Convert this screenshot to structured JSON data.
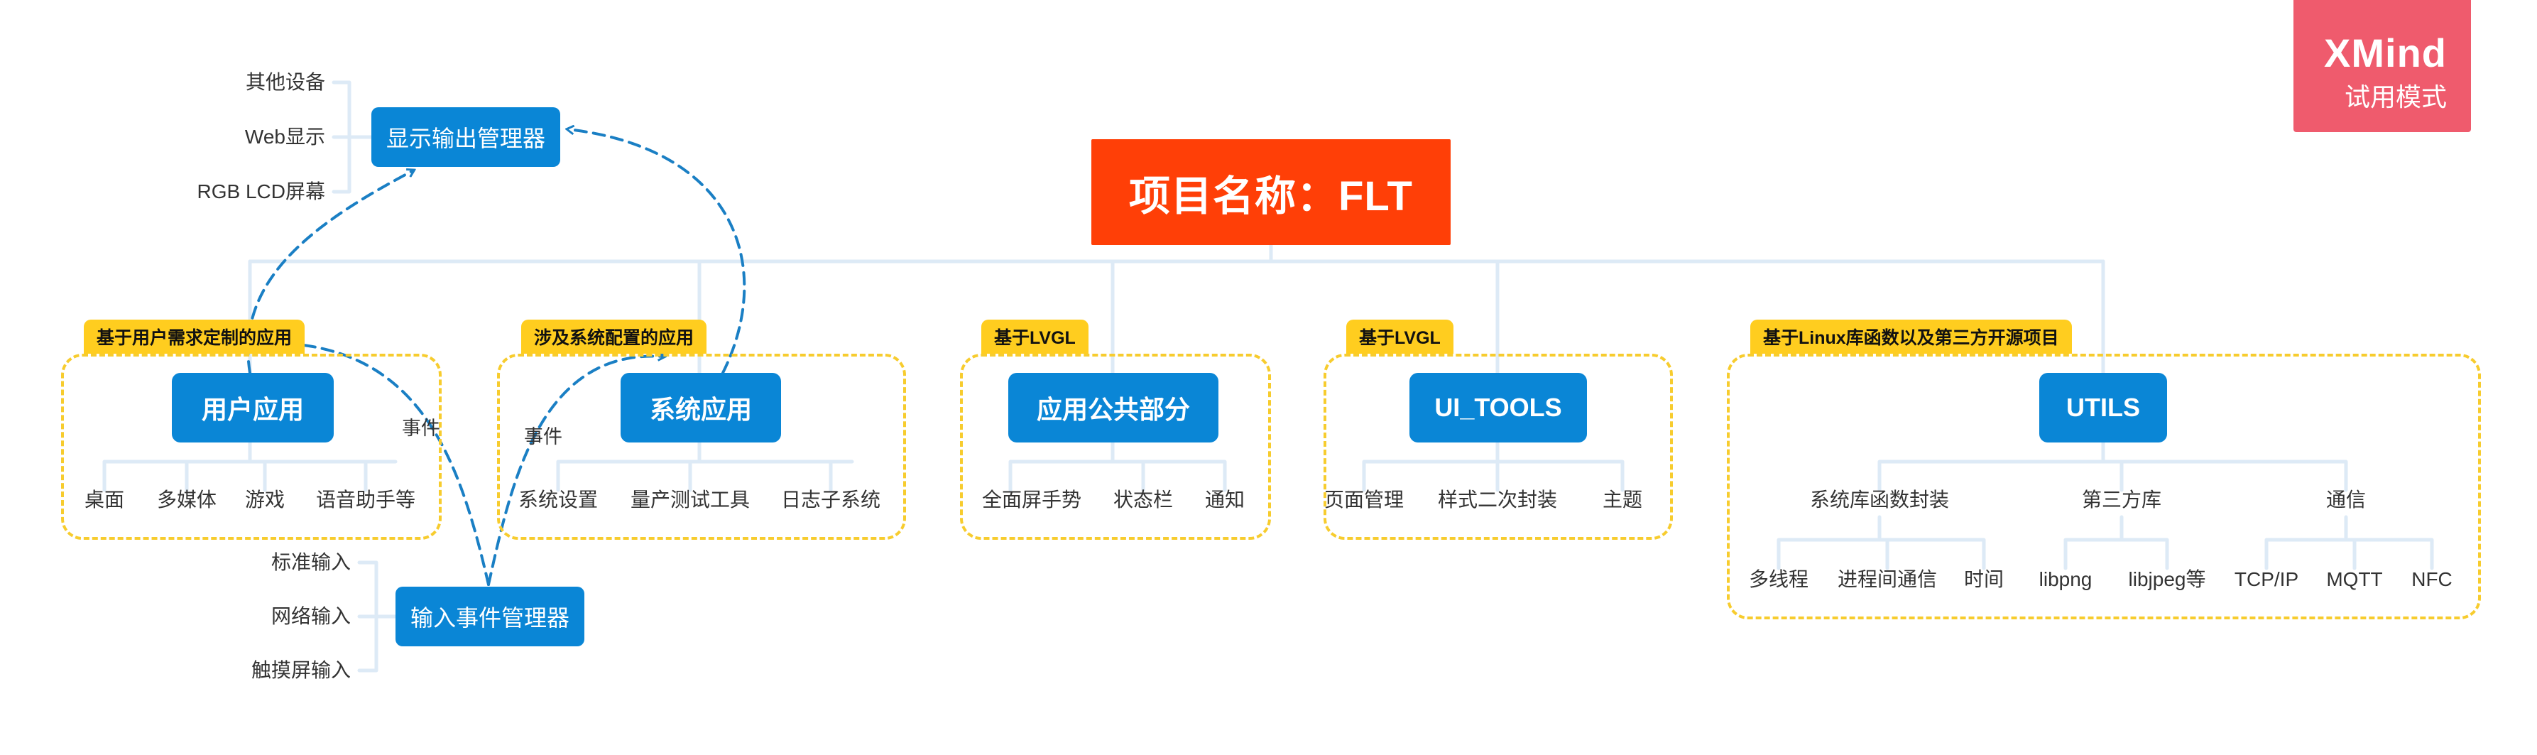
{
  "watermark": {
    "brand": "XMind",
    "trial": "试用模式"
  },
  "root": {
    "title": "项目名称：FLT"
  },
  "groups": [
    {
      "tag": "基于用户需求定制的应用",
      "title": "用户应用",
      "children": [
        "桌面",
        "多媒体",
        "游戏",
        "语音助手等"
      ]
    },
    {
      "tag": "涉及系统配置的应用",
      "title": "系统应用",
      "children": [
        "系统设置",
        "量产测试工具",
        "日志子系统"
      ]
    },
    {
      "tag": "基于LVGL",
      "title": "应用公共部分",
      "children": [
        "全面屏手势",
        "状态栏",
        "通知"
      ]
    },
    {
      "tag": "基于LVGL",
      "title": "UI_TOOLS",
      "children": [
        "页面管理",
        "样式二次封装",
        "主题"
      ]
    },
    {
      "tag": "基于Linux库函数以及第三方开源项目",
      "title": "UTILS",
      "subgroups": [
        {
          "title": "系统库函数封装",
          "children": [
            "多线程",
            "进程间通信",
            "时间"
          ]
        },
        {
          "title": "第三方库",
          "children": [
            "libpng",
            "libjpeg等"
          ]
        },
        {
          "title": "通信",
          "children": [
            "TCP/IP",
            "MQTT",
            "NFC"
          ]
        }
      ]
    }
  ],
  "display_manager": {
    "title": "显示输出管理器",
    "children": [
      "其他设备",
      "Web显示",
      "RGB LCD屏幕"
    ]
  },
  "input_manager": {
    "title": "输入事件管理器",
    "children": [
      "标准输入",
      "网络输入",
      "触摸屏输入"
    ]
  },
  "relations": {
    "event_label_1": "事件",
    "event_label_2": "事件"
  },
  "colors": {
    "root": "#ff3f07",
    "topic": "#0a86d6",
    "tag": "#ffcd1f",
    "group_border": "#f7cc2e",
    "branch_line": "#ddeaf6",
    "relation_line": "#1a7fc4",
    "watermark": "#ef5b6d"
  }
}
